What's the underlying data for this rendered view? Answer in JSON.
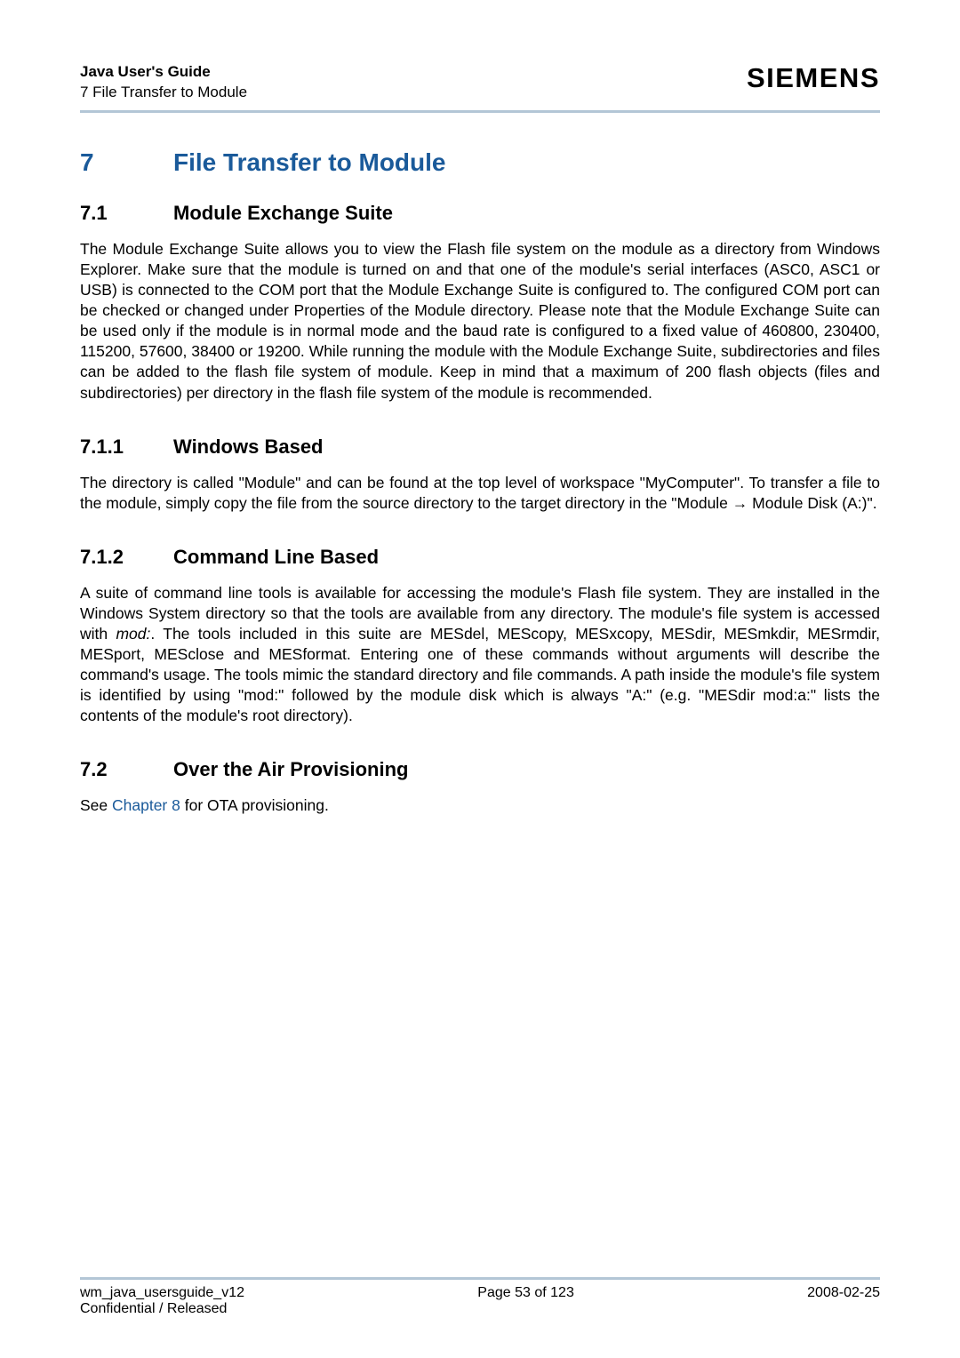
{
  "header": {
    "title": "Java User's Guide",
    "sub": "7 File Transfer to Module",
    "brand": "SIEMENS"
  },
  "main_heading": {
    "num": "7",
    "text": "File Transfer to Module"
  },
  "sections": [
    {
      "num": "7.1",
      "title": "Module Exchange Suite",
      "body": "The Module Exchange Suite allows you to view the Flash file system on the module as a directory from Windows Explorer. Make sure that the module is turned on and that one of the module's serial interfaces (ASC0, ASC1 or USB) is connected to the COM port that the Module Exchange Suite is configured to. The configured COM port can be checked or changed under Properties of the Module directory.  Please note that the Module Exchange Suite can be used only if the module is in normal mode and the baud rate is configured to a fixed value of 460800, 230400, 115200, 57600, 38400 or 19200.  While running the module with the Module Exchange Suite, subdirectories and files can be added to the flash file system of module. Keep in mind that a maximum of 200 flash objects (files and subdirectories) per directory in the flash file system of the module is recommended."
    },
    {
      "num": "7.1.1",
      "title": "Windows Based",
      "body_pre": "The directory is called \"Module\" and can be found at the top level of workspace \"MyComputer\". To transfer a file to the module, simply copy the file from the source directory to the target directory in the \"Module ",
      "body_post": " Module Disk (A:)\"."
    },
    {
      "num": "7.1.2",
      "title": "Command Line Based",
      "body_pre": "A suite of command line tools is available for accessing the module's Flash file system. They are installed in the Windows System directory so that the tools are available from any directory. The module's file system is accessed with ",
      "body_em": "mod:",
      "body_post": ". The tools included in this suite are MESdel, MEScopy, MESxcopy, MESdir, MESmkdir, MESrmdir, MESport, MESclose and MESformat. Entering one of these commands without arguments will describe the command's usage. The tools mimic the standard directory and file commands. A path inside the module's file system is identified by using \"mod:\" followed by the module disk which is always \"A:\" (e.g. \"MESdir mod:a:\" lists the contents of the module's root directory)."
    },
    {
      "num": "7.2",
      "title": "Over the Air Provisioning",
      "body_pre": "See ",
      "body_link": "Chapter 8",
      "body_post": " for OTA provisioning."
    }
  ],
  "footer": {
    "left1": "wm_java_usersguide_v12",
    "left2": "Confidential / Released",
    "center": "Page 53 of 123",
    "right": "2008-02-25"
  }
}
